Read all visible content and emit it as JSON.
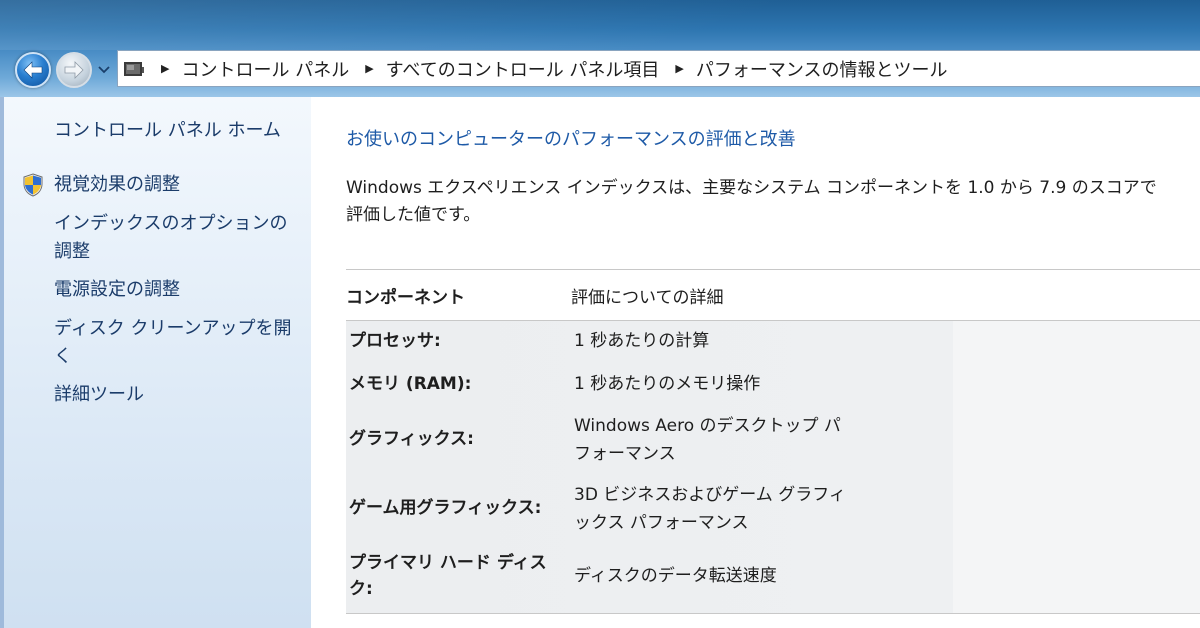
{
  "breadcrumb": {
    "items": [
      "コントロール パネル",
      "すべてのコントロール パネル項目",
      "パフォーマンスの情報とツール"
    ]
  },
  "sidebar": {
    "items": [
      {
        "label": "コントロール パネル ホーム"
      },
      {
        "label": "視覚効果の調整"
      },
      {
        "label": "インデックスのオプションの\n調整"
      },
      {
        "label": "電源設定の調整"
      },
      {
        "label": "ディスク クリーンアップを開\nく"
      },
      {
        "label": "詳細ツール"
      }
    ]
  },
  "main": {
    "heading": "お使いのコンピューターのパフォーマンスの評価と改善",
    "description": "Windows エクスペリエンス インデックスは、主要なシステム コンポーネントを 1.0 から 7.9 のスコアで\n評価した値です。",
    "table": {
      "headers": [
        "コンポーネント",
        "評価についての詳細"
      ],
      "rows": [
        {
          "component": "プロセッサ:",
          "detail": "1 秒あたりの計算"
        },
        {
          "component": "メモリ (RAM):",
          "detail": "1 秒あたりのメモリ操作"
        },
        {
          "component": "グラフィックス:",
          "detail": "Windows Aero のデスクトップ パ\nフォーマンス"
        },
        {
          "component": "ゲーム用グラフィックス:",
          "detail": "3D ビジネスおよびゲーム グラフィ\nックス パフォーマンス"
        },
        {
          "component": "プライマリ ハード ディス\nク:",
          "detail": "ディスクのデータ転送速度"
        }
      ]
    }
  },
  "icons": {
    "back": "back-arrow-icon",
    "forward": "forward-arrow-icon",
    "history": "chevron-down-icon",
    "address": "control-panel-icon",
    "shield": "uac-shield-icon"
  },
  "colors": {
    "link": "#1b3c6a",
    "heading": "#1e5aa7",
    "titlebar": "#2d75b0"
  }
}
